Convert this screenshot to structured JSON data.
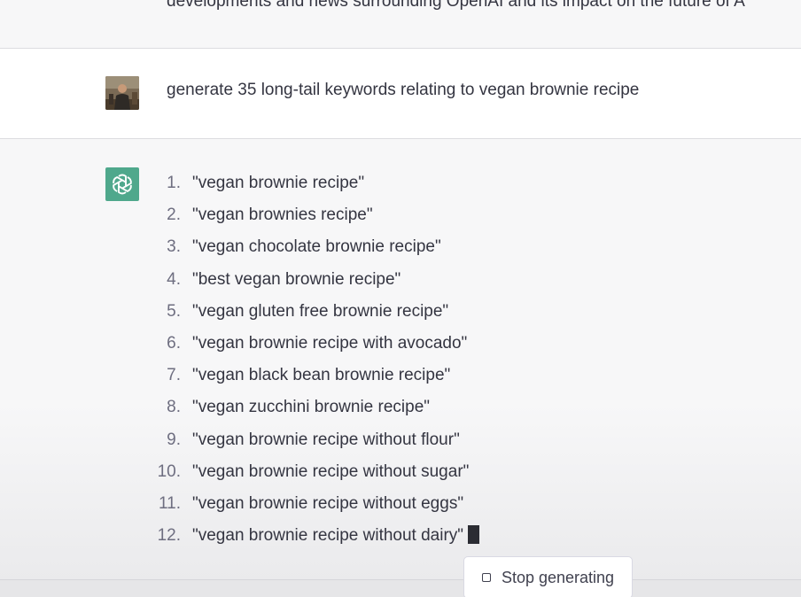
{
  "conversation": {
    "previous_message_text": "developments and news surrounding OpenAI and its impact on the future of A",
    "user_message": {
      "text": "generate 35 long-tail keywords relating to vegan brownie recipe",
      "avatar_icon": "user-photo-avatar"
    },
    "assistant_message": {
      "logo_icon": "openai-logo-icon",
      "logo_color": "#4fa88c",
      "items": [
        {
          "num": "1.",
          "text": "\"vegan brownie recipe\""
        },
        {
          "num": "2.",
          "text": "\"vegan brownies recipe\""
        },
        {
          "num": "3.",
          "text": "\"vegan chocolate brownie recipe\""
        },
        {
          "num": "4.",
          "text": "\"best vegan brownie recipe\""
        },
        {
          "num": "5.",
          "text": "\"vegan gluten free brownie recipe\""
        },
        {
          "num": "6.",
          "text": "\"vegan brownie recipe with avocado\""
        },
        {
          "num": "7.",
          "text": "\"vegan black bean brownie recipe\""
        },
        {
          "num": "8.",
          "text": "\"vegan zucchini brownie recipe\""
        },
        {
          "num": "9.",
          "text": "\"vegan brownie recipe without flour\""
        },
        {
          "num": "10.",
          "text": "\"vegan brownie recipe without sugar\""
        },
        {
          "num": "11.",
          "text": "\"vegan brownie recipe without eggs\""
        },
        {
          "num": "12.",
          "text": "\"vegan brownie recipe without dairy\""
        }
      ]
    }
  },
  "controls": {
    "stop_button_label": "Stop generating",
    "stop_icon": "stop-square-icon"
  }
}
